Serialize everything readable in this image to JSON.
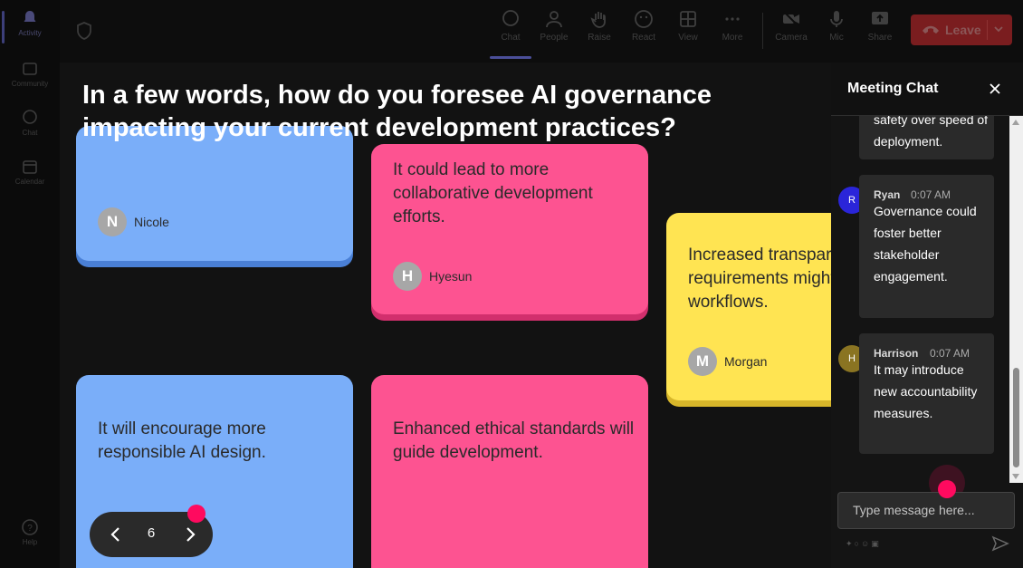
{
  "rail": {
    "items": [
      {
        "label": "Activity",
        "icon": "bell-icon",
        "active": true
      },
      {
        "label": "Community",
        "icon": "community-icon"
      },
      {
        "label": "Chat",
        "icon": "chat-icon"
      },
      {
        "label": "Calendar",
        "icon": "calendar-icon"
      },
      {
        "label": "Help",
        "icon": "help-icon"
      }
    ]
  },
  "toolbar": {
    "chat": "Chat",
    "people": "People",
    "raise": "Raise",
    "react": "React",
    "view": "View",
    "more": "More",
    "camera": "Camera",
    "mic": "Mic",
    "share": "Share",
    "leave": "Leave"
  },
  "question": "In a few words, how do you foresee AI governance impacting your current development practices?",
  "notes": [
    {
      "color": "blue",
      "text": "",
      "author": "Nicole",
      "initial": "N"
    },
    {
      "color": "pink",
      "text": "It could lead to more collaborative development efforts.",
      "author": "Hyesun",
      "initial": "H"
    },
    {
      "color": "yellow",
      "text": "Increased transparency requirements might change workflows.",
      "author": "Morgan",
      "initial": "M"
    },
    {
      "color": "blue",
      "text": "It will encourage more responsible AI design.",
      "author": "",
      "initial": ""
    },
    {
      "color": "pink",
      "text": "Enhanced ethical standards will guide development.",
      "author": "",
      "initial": ""
    }
  ],
  "pager": {
    "page": "6"
  },
  "chat": {
    "title": "Meeting Chat",
    "messages": [
      {
        "name": "",
        "time": "",
        "body": "safety over speed of deployment."
      },
      {
        "name": "Ryan",
        "initial": "R",
        "time": "0:07 AM",
        "body": "Governance could foster better stakeholder engagement.",
        "avatar_color": "#2a25d9"
      },
      {
        "name": "Harrison",
        "initial": "H",
        "time": "0:07 AM",
        "body": "It may introduce new accountability measures.",
        "avatar_color": "#8a7422"
      }
    ],
    "input_placeholder": "Type message here..."
  },
  "colors": {
    "accent": "#ff0a5f",
    "blue_note": "#7aaef9",
    "pink_note": "#fd5391",
    "yellow_note": "#ffe452",
    "leave": "#7a1d1f"
  }
}
